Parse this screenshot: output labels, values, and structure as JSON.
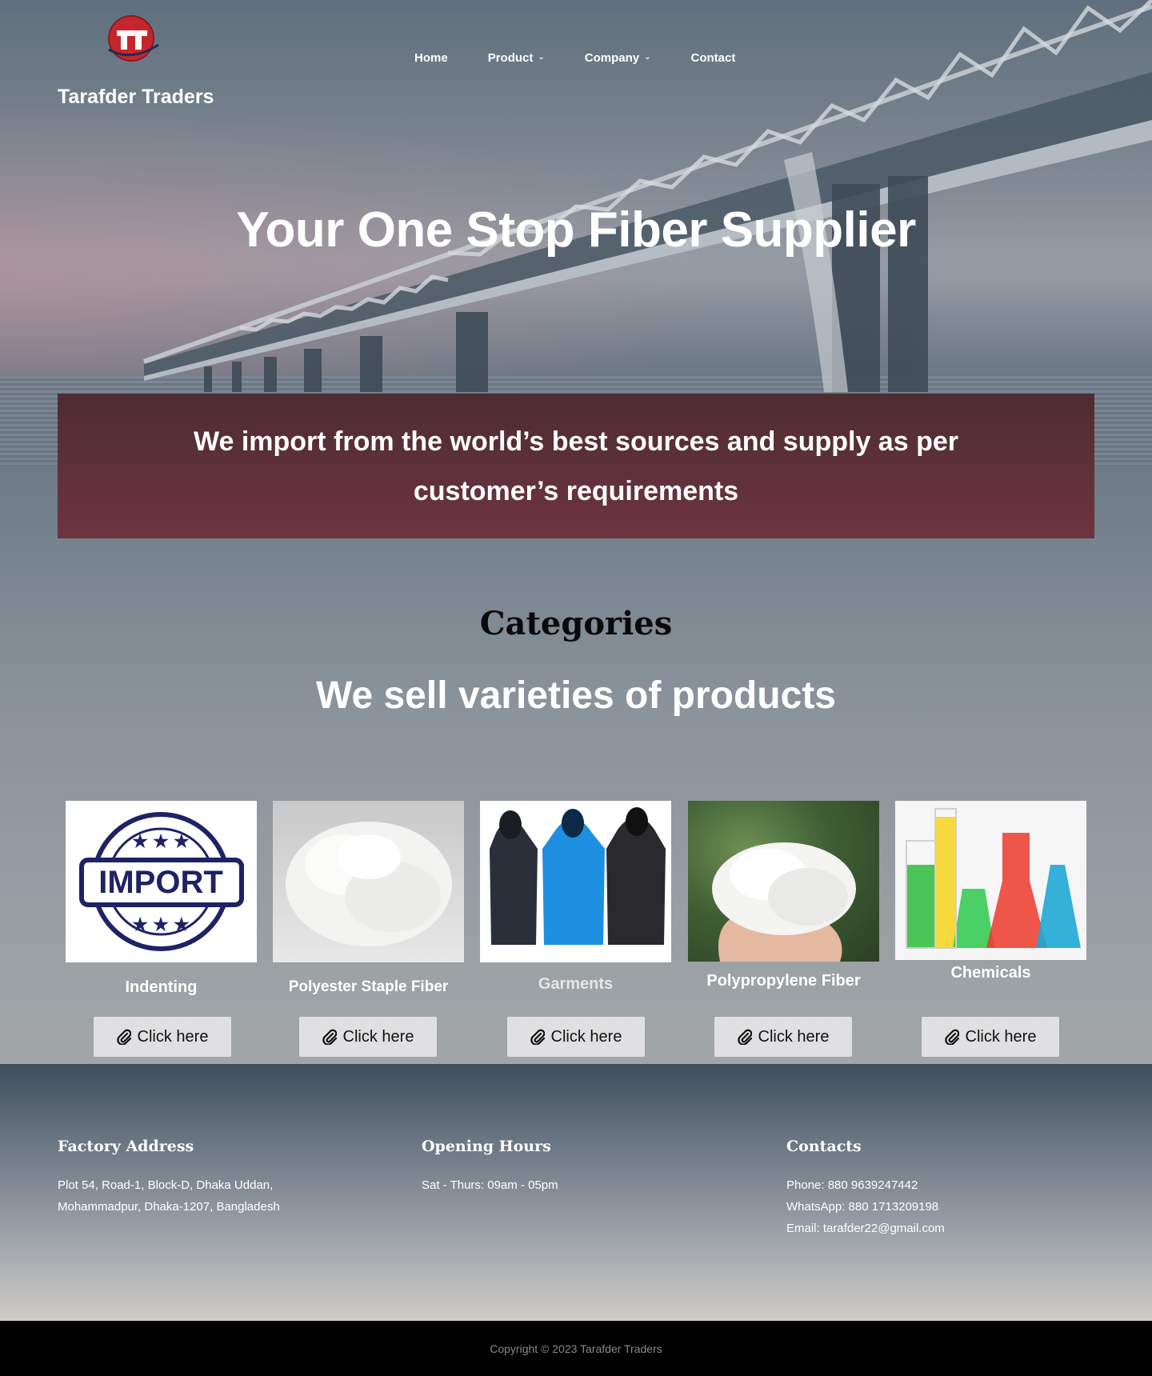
{
  "brand": {
    "name": "Tarafder Traders",
    "logo": "tt-logo"
  },
  "nav": {
    "items": [
      {
        "label": "Home",
        "has_dropdown": false
      },
      {
        "label": "Product",
        "has_dropdown": true
      },
      {
        "label": "Company",
        "has_dropdown": true
      },
      {
        "label": "Contact",
        "has_dropdown": false
      }
    ]
  },
  "hero": {
    "title": "Your One Stop Fiber Supplier"
  },
  "banner": {
    "text": "We import from the world’s best sources and supply as per customer’s requirements"
  },
  "categories": {
    "label": "Categories",
    "subtitle": "We sell varieties of products",
    "items": [
      {
        "name": "Indenting",
        "button": "Click here",
        "icon": "paperclip-icon"
      },
      {
        "name": "Polyester Staple Fiber",
        "button": "Click here",
        "icon": "paperclip-icon"
      },
      {
        "name": "Garments",
        "button": "Click here",
        "icon": "paperclip-icon"
      },
      {
        "name": "Polypropylene Fiber",
        "button": "Click here",
        "icon": "paperclip-icon"
      },
      {
        "name": "Chemicals",
        "button": "Click here",
        "icon": "paperclip-icon"
      }
    ]
  },
  "footer": {
    "factory": {
      "title": "Factory Address",
      "line1": "Plot 54, Road-1, Block-D, Dhaka Uddan,",
      "line2": "Mohammadpur, Dhaka-1207, Bangladesh"
    },
    "hours": {
      "title": "Opening Hours",
      "line1": "Sat - Thurs: 09am - 05pm"
    },
    "contacts": {
      "title": "Contacts",
      "phone": "Phone: 880 9639247442",
      "whatsapp": "WhatsApp: 880 1713209198",
      "email": "Email: tarafder22@gmail.com"
    },
    "copyright": "Copyright © 2023 Tarafder Traders"
  },
  "colors": {
    "banner": "#5e3039",
    "button_bg": "#e0e0e2",
    "footer_bar": "#000000"
  }
}
